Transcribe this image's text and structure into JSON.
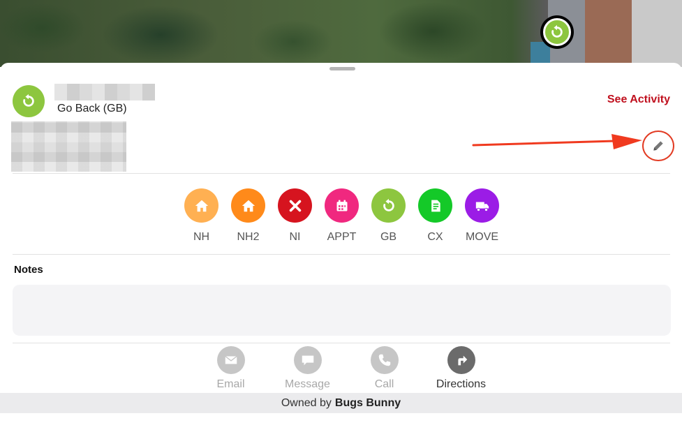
{
  "map": {
    "pin_status_icon": "go-back-icon",
    "pin_color": "#8dc63f"
  },
  "lead": {
    "status_icon": "go-back-icon",
    "status_color": "#8dc63f",
    "status_label": "Go Back (GB)",
    "see_activity_label": "See Activity"
  },
  "status_options": [
    {
      "label": "NH",
      "color": "#ffb052",
      "icon": "home-icon"
    },
    {
      "label": "NH2",
      "color": "#ff8a1a",
      "icon": "home-icon"
    },
    {
      "label": "NI",
      "color": "#d6141f",
      "icon": "close-icon"
    },
    {
      "label": "APPT",
      "color": "#f0287f",
      "icon": "calendar-icon"
    },
    {
      "label": "GB",
      "color": "#8dc63f",
      "icon": "go-back-icon"
    },
    {
      "label": "CX",
      "color": "#14c928",
      "icon": "contract-icon"
    },
    {
      "label": "MOVE",
      "color": "#9b1ce6",
      "icon": "truck-icon"
    }
  ],
  "notes": {
    "title": "Notes",
    "value": ""
  },
  "actions": [
    {
      "label": "Email",
      "icon": "email-icon",
      "enabled": false
    },
    {
      "label": "Message",
      "icon": "message-icon",
      "enabled": false
    },
    {
      "label": "Call",
      "icon": "phone-icon",
      "enabled": false
    },
    {
      "label": "Directions",
      "icon": "directions-icon",
      "enabled": true
    }
  ],
  "footer": {
    "owned_by_prefix": "Owned by",
    "owner_name": "Bugs Bunny"
  },
  "colors": {
    "accent_red": "#c0101e",
    "annotation_red": "#e23b23"
  }
}
